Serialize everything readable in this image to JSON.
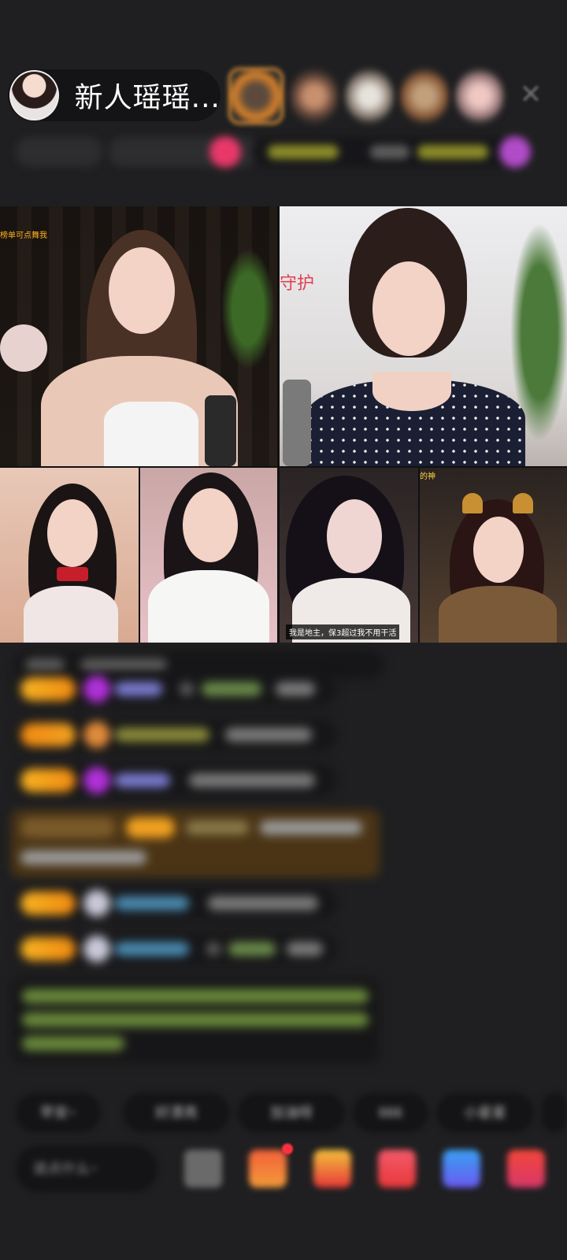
{
  "host": {
    "name": "新人瑶瑶...",
    "avatar_icon": "host-avatar"
  },
  "header": {
    "close_icon": "close-icon",
    "close_glyph": "✕"
  },
  "video_tiles": {
    "tile1_label": "榜单可点舞我",
    "tile2_label": "守护",
    "tile5_label": "的神",
    "tile4_subtitle": "我是地主，保3超过我不用干活"
  },
  "quick_replies": [
    "早安~",
    "好漂亮",
    "加油呀",
    "666",
    "小星星"
  ],
  "input": {
    "placeholder": "说点什么~"
  },
  "colors": {
    "accent_orange": "#f6b322",
    "background": "#1f1f21",
    "pill": "#141416",
    "highlight_message": "#4a3415",
    "notify": "#ff3040"
  }
}
